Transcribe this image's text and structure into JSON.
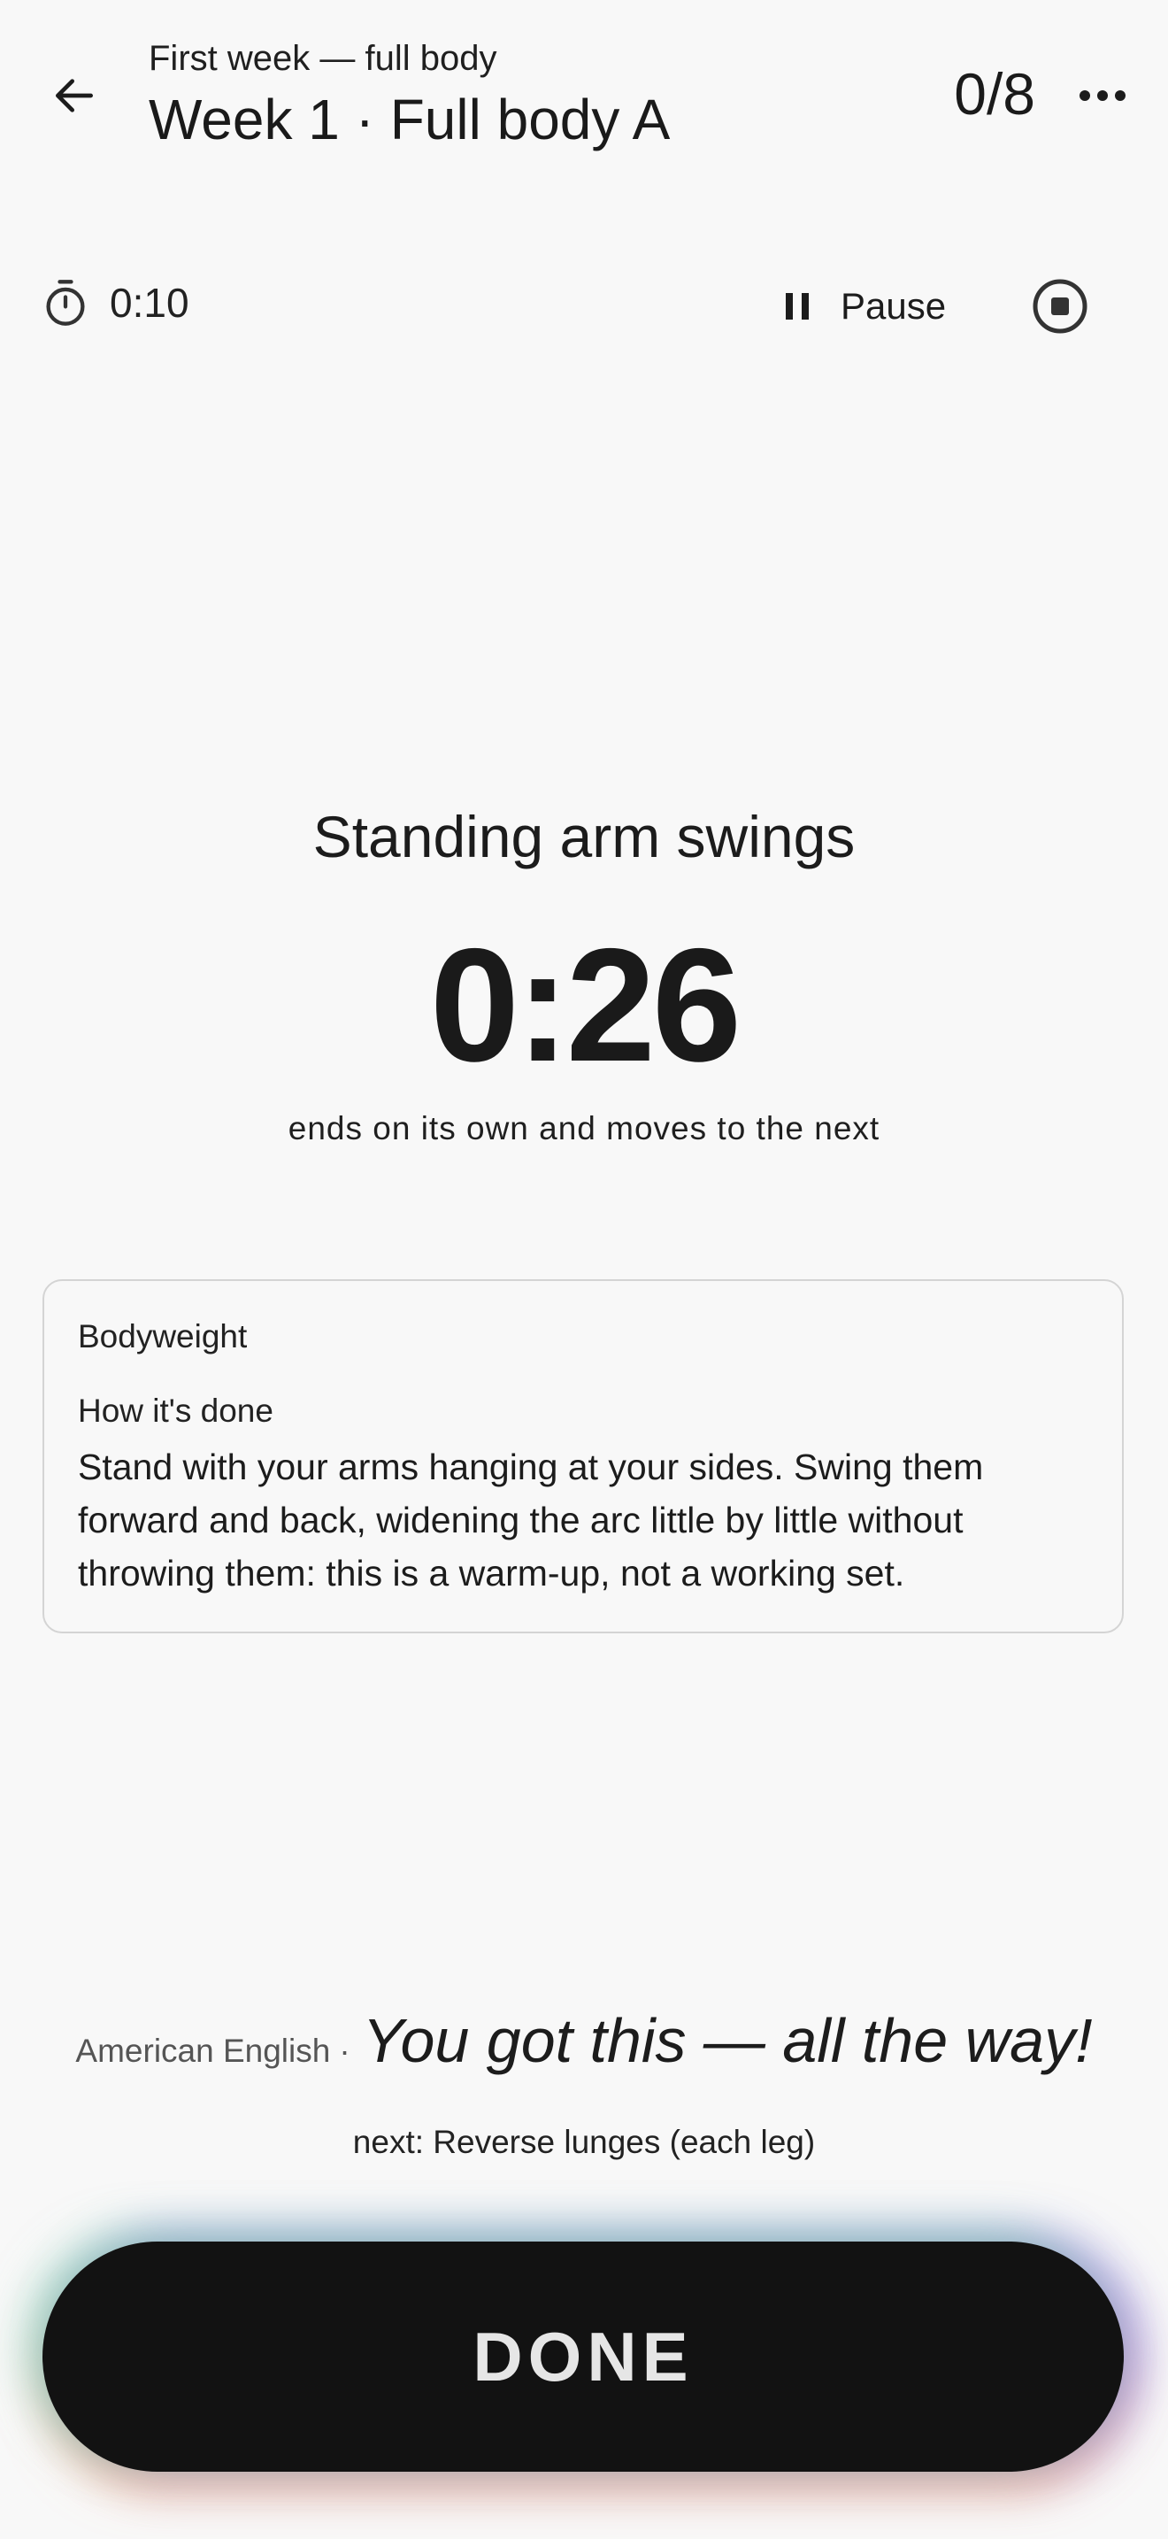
{
  "header": {
    "subtitle": "First week — full body",
    "title": "Week 1 · Full body A",
    "progress": "0/8",
    "back_icon": "arrow-left-icon",
    "more_icon": "more-horizontal-icon"
  },
  "timer_bar": {
    "elapsed": "0:10",
    "pause_label": "Pause",
    "timer_icon": "stopwatch-icon",
    "pause_icon": "pause-icon",
    "stop_icon": "stop-circle-icon"
  },
  "exercise": {
    "name": "Standing arm swings",
    "countdown": "0:26",
    "countdown_note": "ends on its own and moves to the next"
  },
  "info_card": {
    "equipment": "Bodyweight",
    "howto_label": "How it's done",
    "howto_text": "Stand with your arms hanging at your sides. Swing them forward and back, widening the arc little by little without throwing them: this is a warm-up, not a working set."
  },
  "motivation": {
    "language": "American English",
    "separator": "·",
    "quote": "You got this — all the way!"
  },
  "next_exercise": "next: Reverse lunges (each leg)",
  "done_button": {
    "label": "DONE"
  },
  "colors": {
    "background": "#f8f8f8",
    "text": "#1c1c1c",
    "done_button": "#121212",
    "done_label": "#e6e6e6",
    "card_border": "#d4d4d4"
  }
}
